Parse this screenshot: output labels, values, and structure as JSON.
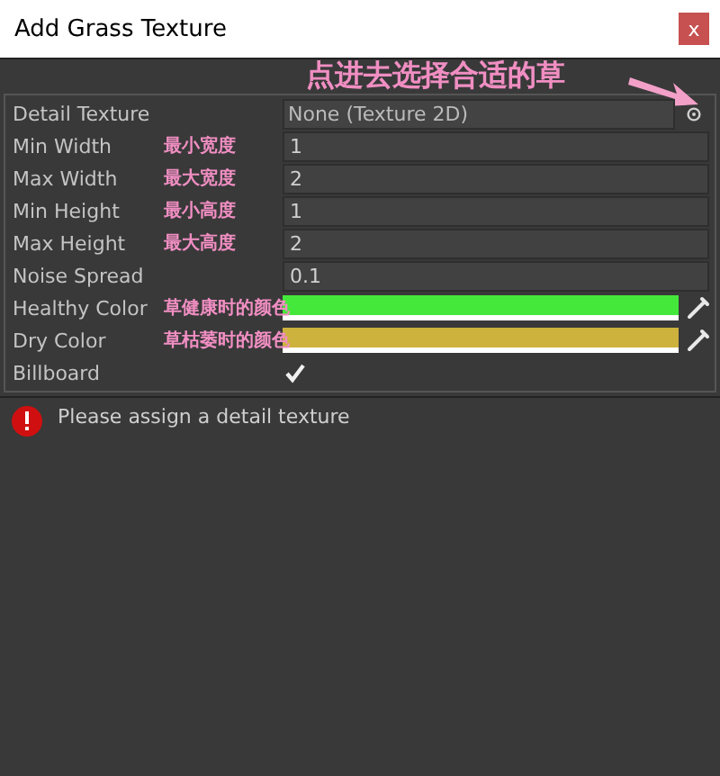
{
  "window": {
    "title": "Add Grass Texture",
    "close": "x"
  },
  "hint": "点进去选择合适的草",
  "fields": [
    {
      "kind": "object",
      "label": "Detail Texture",
      "value": "None (Texture 2D)"
    },
    {
      "kind": "number",
      "label": "Min Width",
      "value": "1",
      "note": "最小宽度"
    },
    {
      "kind": "number",
      "label": "Max Width",
      "value": "2",
      "note": "最大宽度"
    },
    {
      "kind": "number",
      "label": "Min Height",
      "value": "1",
      "note": "最小高度"
    },
    {
      "kind": "number",
      "label": "Max Height",
      "value": "2",
      "note": "最大高度"
    },
    {
      "kind": "number",
      "label": "Noise Spread",
      "value": "0.1"
    },
    {
      "kind": "color",
      "label": "Healthy Color",
      "color": "#44e83a",
      "note": "草健康时的颜色"
    },
    {
      "kind": "color",
      "label": "Dry Color",
      "color": "#cdb23d",
      "note": "草枯萎时的颜色"
    },
    {
      "kind": "toggle",
      "label": "Billboard",
      "checked": true
    }
  ],
  "message": "Please assign a detail texture"
}
